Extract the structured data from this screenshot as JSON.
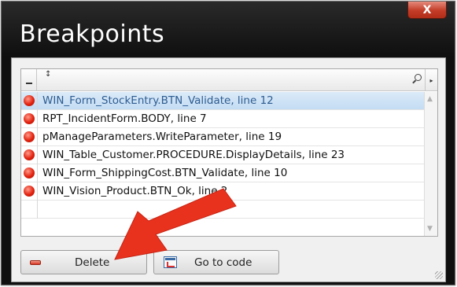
{
  "window": {
    "title": "Breakpoints",
    "close_label": "X"
  },
  "grid": {
    "header": {
      "sort_glyph": "↕",
      "right_glyph": "▸"
    },
    "rows": [
      {
        "text": "WIN_Form_StockEntry.BTN_Validate, line 12",
        "selected": true
      },
      {
        "text": "RPT_IncidentForm.BODY, line 7",
        "selected": false
      },
      {
        "text": "pManageParameters.WriteParameter, line 19",
        "selected": false
      },
      {
        "text": "WIN_Table_Customer.PROCEDURE.DisplayDetails, line 23",
        "selected": false
      },
      {
        "text": "WIN_Form_ShippingCost.BTN_Validate, line 10",
        "selected": false
      },
      {
        "text": "WIN_Vision_Product.BTN_Ok, line 2",
        "selected": false
      }
    ]
  },
  "buttons": {
    "delete_label": "Delete",
    "goto_label": "Go to code"
  },
  "colors": {
    "selection": "#c3dcf3",
    "breakpoint": "#e3220f",
    "annotation_arrow": "#e8321e"
  }
}
